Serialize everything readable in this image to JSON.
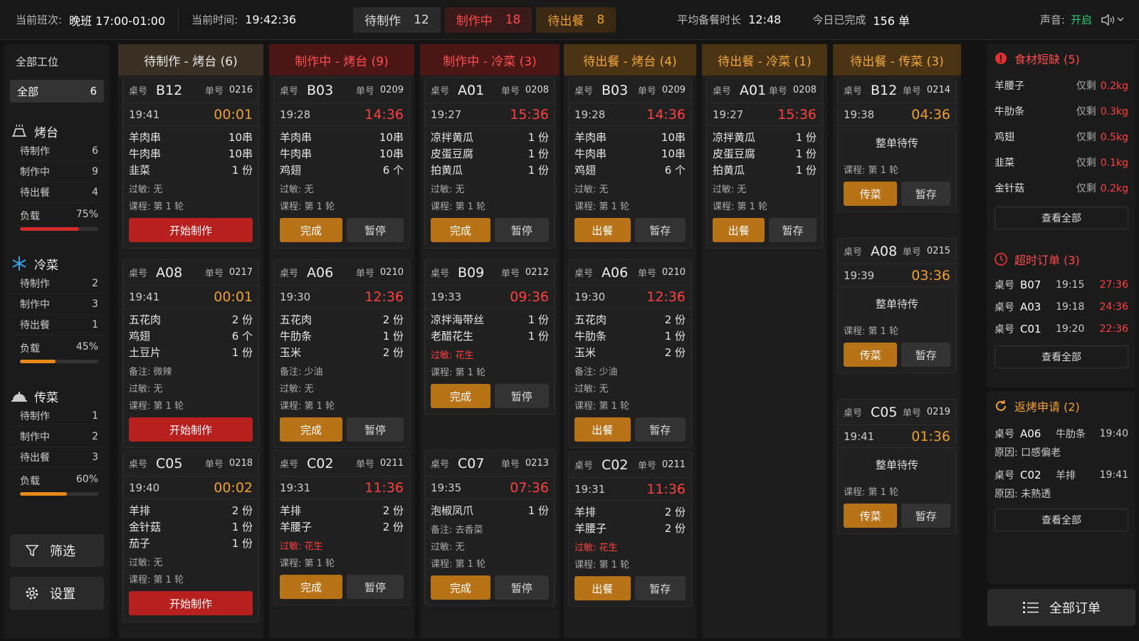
{
  "topbar": {
    "shift_label": "当前班次:",
    "shift_value": "晚班 17:00-01:00",
    "time_label": "当前时间:",
    "time_value": "19:42:36",
    "stats": [
      {
        "label": "待制作",
        "value": "12"
      },
      {
        "label": "制作中",
        "value": "18"
      },
      {
        "label": "待出餐",
        "value": "8"
      }
    ],
    "avg_label": "平均备餐时长",
    "avg_value": "12:48",
    "done_label": "今日已完成",
    "done_value": "156 单",
    "sound_label": "声音:",
    "sound_value": "开启"
  },
  "sidebar": {
    "all_stations": "全部工位",
    "all": {
      "label": "全部",
      "count": "6"
    },
    "sections": [
      {
        "icon": "grill-icon",
        "title": "烤台",
        "rows": [
          {
            "label": "待制作",
            "value": "6"
          },
          {
            "label": "制作中",
            "value": "9"
          },
          {
            "label": "待出餐",
            "value": "4"
          }
        ],
        "load_label": "负载",
        "load_value": "75%",
        "load_pct": 75,
        "color": "#d62b2b"
      },
      {
        "icon": "snowflake-icon",
        "title": "冷菜",
        "rows": [
          {
            "label": "待制作",
            "value": "2"
          },
          {
            "label": "制作中",
            "value": "3"
          },
          {
            "label": "待出餐",
            "value": "1"
          }
        ],
        "load_label": "负载",
        "load_value": "45%",
        "load_pct": 45,
        "color": "#e8891a"
      },
      {
        "icon": "serving-bell-icon",
        "title": "传菜",
        "rows": [
          {
            "label": "待制作",
            "value": "1"
          },
          {
            "label": "制作中",
            "value": "2"
          },
          {
            "label": "待出餐",
            "value": "3"
          }
        ],
        "load_label": "负载",
        "load_value": "60%",
        "load_pct": 60,
        "color": "#e8891a"
      }
    ],
    "filter_label": "筛选",
    "settings_label": "设置"
  },
  "common": {
    "table_label": "桌号",
    "order_label": "单号",
    "allergy_label": "过敏:",
    "course_label": "课程:",
    "note_label": "备注:",
    "reason_label": "原因:"
  },
  "columns": [
    {
      "header": "待制作 - 烤台 (6)",
      "cards": [
        {
          "table": "B12",
          "order": "0216",
          "time": "19:41",
          "elapsed": "00:01",
          "items": [
            {
              "name": "羊肉串",
              "qty": "10串"
            },
            {
              "name": "牛肉串",
              "qty": "10串"
            },
            {
              "name": "韭菜",
              "qty": "1 份"
            }
          ],
          "allergy": "无",
          "course": "第 1 轮",
          "buttons": [
            "开始制作"
          ]
        },
        {
          "table": "A08",
          "order": "0217",
          "time": "19:41",
          "elapsed": "00:01",
          "items": [
            {
              "name": "五花肉",
              "qty": "2 份"
            },
            {
              "name": "鸡翅",
              "qty": "6 个"
            },
            {
              "name": "土豆片",
              "qty": "1 份"
            }
          ],
          "note": "微辣",
          "allergy": "无",
          "course": "第 1 轮",
          "buttons": [
            "开始制作"
          ]
        },
        {
          "table": "C05",
          "order": "0218",
          "time": "19:40",
          "elapsed": "00:02",
          "items": [
            {
              "name": "羊排",
              "qty": "2 份"
            },
            {
              "name": "金针菇",
              "qty": "1 份"
            },
            {
              "name": "茄子",
              "qty": "1 份"
            }
          ],
          "allergy": "无",
          "course": "第 1 轮",
          "buttons": [
            "开始制作"
          ]
        }
      ]
    },
    {
      "header": "制作中 - 烤台 (9)",
      "cards": [
        {
          "table": "B03",
          "order": "0209",
          "time": "19:28",
          "elapsed": "14:36",
          "items": [
            {
              "name": "羊肉串",
              "qty": "10串"
            },
            {
              "name": "牛肉串",
              "qty": "10串"
            },
            {
              "name": "鸡翅",
              "qty": "6 个"
            }
          ],
          "allergy": "无",
          "course": "第 1 轮",
          "buttons": [
            "完成",
            "暂停"
          ]
        },
        {
          "table": "A06",
          "order": "0210",
          "time": "19:30",
          "elapsed": "12:36",
          "items": [
            {
              "name": "五花肉",
              "qty": "2 份"
            },
            {
              "name": "牛肋条",
              "qty": "1 份"
            },
            {
              "name": "玉米",
              "qty": "2 份"
            }
          ],
          "note": "少油",
          "allergy": "无",
          "course": "第 1 轮",
          "buttons": [
            "完成",
            "暂停"
          ]
        },
        {
          "table": "C02",
          "order": "0211",
          "time": "19:31",
          "elapsed": "11:36",
          "items": [
            {
              "name": "羊排",
              "qty": "2 份"
            },
            {
              "name": "羊腰子",
              "qty": "2 份"
            }
          ],
          "allergy": "花生",
          "course": "第 1 轮",
          "buttons": [
            "完成",
            "暂停"
          ]
        }
      ]
    },
    {
      "header": "制作中 - 冷菜 (3)",
      "cards": [
        {
          "table": "A01",
          "order": "0208",
          "time": "19:27",
          "elapsed": "15:36",
          "items": [
            {
              "name": "凉拌黄瓜",
              "qty": "1 份"
            },
            {
              "name": "皮蛋豆腐",
              "qty": "1 份"
            },
            {
              "name": "拍黄瓜",
              "qty": "1 份"
            }
          ],
          "allergy": "无",
          "course": "第 1 轮",
          "buttons": [
            "完成",
            "暂停"
          ]
        },
        {
          "table": "B09",
          "order": "0212",
          "time": "19:33",
          "elapsed": "09:36",
          "items": [
            {
              "name": "凉拌海带丝",
              "qty": "1 份"
            },
            {
              "name": "老醋花生",
              "qty": "1 份"
            }
          ],
          "allergy": "花生",
          "course": "第 1 轮",
          "buttons": [
            "完成",
            "暂停"
          ]
        },
        {
          "table": "C07",
          "order": "0213",
          "time": "19:35",
          "elapsed": "07:36",
          "items": [
            {
              "name": "泡椒凤爪",
              "qty": "1 份"
            }
          ],
          "note": "去香菜",
          "allergy": "无",
          "course": "第 1 轮",
          "buttons": [
            "完成",
            "暂停"
          ]
        }
      ]
    },
    {
      "header": "待出餐 - 烤台 (4)",
      "cards": [
        {
          "table": "B03",
          "order": "0209",
          "time": "19:28",
          "elapsed": "14:36",
          "items": [
            {
              "name": "羊肉串",
              "qty": "10串"
            },
            {
              "name": "牛肉串",
              "qty": "10串"
            },
            {
              "name": "鸡翅",
              "qty": "6 个"
            }
          ],
          "allergy": "无",
          "course": "第 1 轮",
          "buttons": [
            "出餐",
            "暂存"
          ]
        },
        {
          "table": "A06",
          "order": "0210",
          "time": "19:30",
          "elapsed": "12:36",
          "items": [
            {
              "name": "五花肉",
              "qty": "2 份"
            },
            {
              "name": "牛肋条",
              "qty": "1 份"
            },
            {
              "name": "玉米",
              "qty": "2 份"
            }
          ],
          "note": "少油",
          "allergy": "无",
          "course": "第 1 轮",
          "buttons": [
            "出餐",
            "暂存"
          ]
        },
        {
          "table": "C02",
          "order": "0211",
          "time": "19:31",
          "elapsed": "11:36",
          "items": [
            {
              "name": "羊排",
              "qty": "2 份"
            },
            {
              "name": "羊腰子",
              "qty": "2 份"
            }
          ],
          "allergy": "花生",
          "course": "第 1 轮",
          "buttons": [
            "出餐",
            "暂存"
          ]
        }
      ]
    },
    {
      "header": "待出餐 - 冷菜 (1)",
      "cards": [
        {
          "table": "A01",
          "order": "0208",
          "time": "19:27",
          "elapsed": "15:36",
          "items": [
            {
              "name": "凉拌黄瓜",
              "qty": "1 份"
            },
            {
              "name": "皮蛋豆腐",
              "qty": "1 份"
            },
            {
              "name": "拍黄瓜",
              "qty": "1 份"
            }
          ],
          "allergy": "无",
          "course": "第 1 轮",
          "buttons": [
            "出餐",
            "暂存"
          ]
        }
      ]
    },
    {
      "header": "待出餐 - 传菜 (3)",
      "cards": [
        {
          "table": "B12",
          "order": "0214",
          "time": "19:38",
          "elapsed": "04:36",
          "whole": "整单待传",
          "course": "第 1 轮",
          "buttons": [
            "传菜",
            "暂存"
          ]
        },
        {
          "table": "A08",
          "order": "0215",
          "time": "19:39",
          "elapsed": "03:36",
          "whole": "整单待传",
          "course": "第 1 轮",
          "buttons": [
            "传菜",
            "暂存"
          ]
        },
        {
          "table": "C05",
          "order": "0219",
          "time": "19:41",
          "elapsed": "01:36",
          "whole": "整单待传",
          "course": "第 1 轮",
          "buttons": [
            "传菜",
            "暂存"
          ]
        }
      ]
    }
  ],
  "right": {
    "shortage": {
      "title": "食材短缺 (5)",
      "remain_label": "仅剩",
      "items": [
        {
          "name": "羊腰子",
          "qty": "0.2kg"
        },
        {
          "name": "牛肋条",
          "qty": "0.3kg"
        },
        {
          "name": "鸡翅",
          "qty": "0.5kg"
        },
        {
          "name": "韭菜",
          "qty": "0.1kg"
        },
        {
          "name": "金针菇",
          "qty": "0.2kg"
        }
      ],
      "view_all": "查看全部"
    },
    "overtime": {
      "title": "超时订单 (3)",
      "items": [
        {
          "table": "B07",
          "time": "19:15",
          "over": "27:36"
        },
        {
          "table": "A03",
          "time": "19:18",
          "over": "24:36"
        },
        {
          "table": "C01",
          "time": "19:20",
          "over": "22:36"
        }
      ],
      "view_all": "查看全部"
    },
    "regrill": {
      "title": "返烤申请 (2)",
      "items": [
        {
          "table": "A06",
          "dish": "牛肋条",
          "time": "19:40",
          "reason": "口感偏老"
        },
        {
          "table": "C02",
          "dish": "羊排",
          "time": "19:41",
          "reason": "未熟透"
        }
      ],
      "view_all": "查看全部"
    },
    "all_orders": "全部订单"
  }
}
